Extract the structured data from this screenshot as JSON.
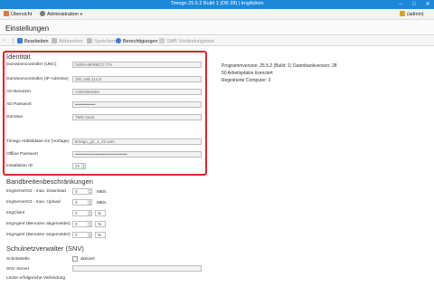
{
  "window": {
    "title": "Timego 25.5.2 Build 1 (DB 28) | tmgAdmin",
    "minimize": "–",
    "maximize": "□",
    "close": "✕"
  },
  "menu": {
    "overview": "Übersicht",
    "administration": "Administration",
    "user": "(admin)"
  },
  "page": {
    "title": "Einstellungen"
  },
  "toolbar": {
    "edit": "Bearbeiten",
    "cancel": "Abbrechen",
    "save": "Speichern",
    "permissions": "Berechtigungen",
    "smb_test": "SMB Verbindungstest"
  },
  "identity": {
    "title": "Identität",
    "fields": [
      {
        "label": "Domänencontroller (UNC)",
        "value": "\\\\SRV-99\\RBC3.7TA"
      },
      {
        "label": "Domänencontroller (IP-Adresse)",
        "value": "192.168.114.5"
      },
      {
        "label": "AD Benutzer",
        "value": "Administrator"
      },
      {
        "label": "AD Passwort",
        "value": "••••••••••••••"
      },
      {
        "label": "Domäne",
        "value": "TMG.local"
      }
    ],
    "image_label": "Timego Abbilddatei G2 (Vorlage)",
    "image_value": "timego_g2_1_22.wim",
    "offline_label": "Offline Passwort",
    "offline_value": "••••••••••••••••••••••••••••••••••••",
    "install_label": "Installation ID",
    "install_value": "22"
  },
  "program_info": {
    "version": "Programmversion: 25.5.2 (Build: 1) Datenbankversion: 28",
    "licenses": "50 Arbeitsplätze lizenziert",
    "registered": "Registrierte Computer: 3"
  },
  "bandwidth": {
    "title": "Bandbreitenbeschränkungen",
    "rows": [
      {
        "label": "tmgServerG2 - max. Download",
        "value": "0",
        "unit": "MB/s"
      },
      {
        "label": "tmgServerG2 - max. Upload",
        "value": "0",
        "unit": "MB/s"
      },
      {
        "label": "tmgClient",
        "value": "0",
        "unit": "%"
      },
      {
        "label": "tmgAgent (Benutzer abgemeldet)",
        "value": "0",
        "unit": "%"
      },
      {
        "label": "tmgAgent (Benutzer angemeldet)",
        "value": "0",
        "unit": "%"
      }
    ]
  },
  "school": {
    "title": "Schulnetzverwalter (SNV)",
    "interface_label": "Schnittstelle",
    "interface_check": "aktiviert",
    "server_label": "SNV Server",
    "server_value": "",
    "last_conn_label": "Letzte erfolgreiche Verbindung"
  },
  "colors": {
    "titlebar": "#1e88d8",
    "highlight": "#d8262e"
  }
}
